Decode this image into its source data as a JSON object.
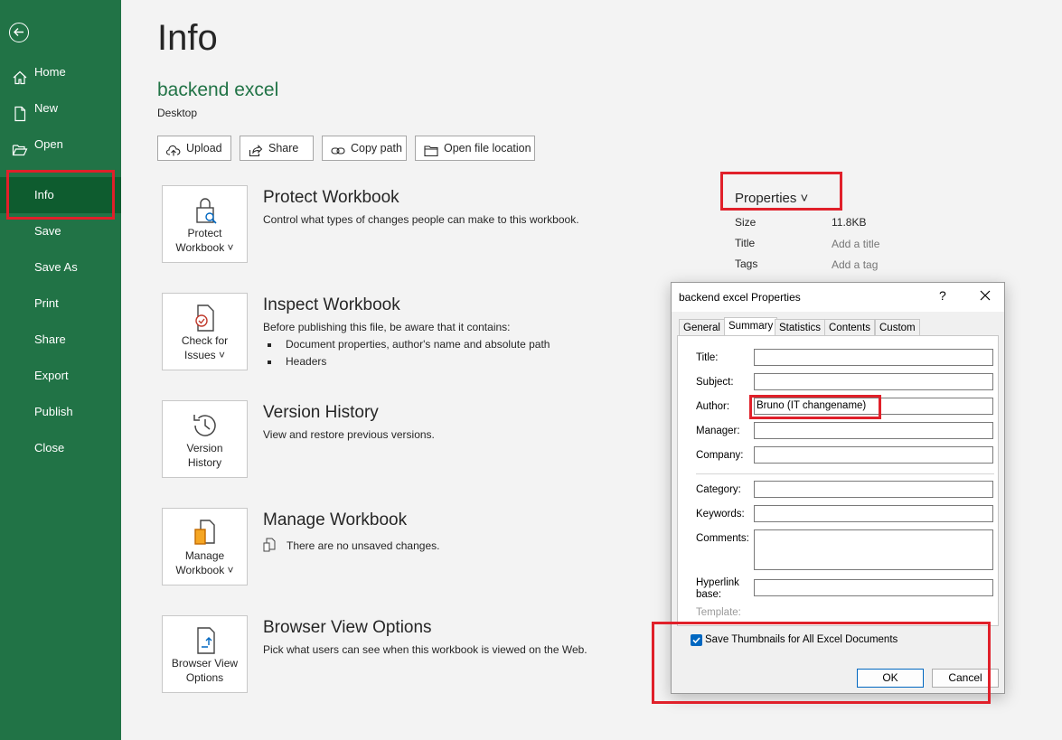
{
  "sidebar": {
    "items": [
      {
        "label": "Home"
      },
      {
        "label": "New"
      },
      {
        "label": "Open"
      },
      {
        "label": "Info"
      },
      {
        "label": "Save"
      },
      {
        "label": "Save As"
      },
      {
        "label": "Print"
      },
      {
        "label": "Share"
      },
      {
        "label": "Export"
      },
      {
        "label": "Publish"
      },
      {
        "label": "Close"
      }
    ]
  },
  "main": {
    "title": "Info",
    "file_name": "backend excel",
    "file_location": "Desktop",
    "actions": [
      {
        "label": "Upload"
      },
      {
        "label": "Share"
      },
      {
        "label": "Copy path"
      },
      {
        "label": "Open file location"
      }
    ],
    "sections": {
      "protect": {
        "tile_label": "Protect\nWorkbook ˅",
        "title": "Protect Workbook",
        "description": "Control what types of changes people can make to this workbook."
      },
      "inspect": {
        "tile_label": "Check for\nIssues ˅",
        "title": "Inspect Workbook",
        "description": "Before publishing this file, be aware that it contains:",
        "bullets": [
          "Document properties, author's name and absolute path",
          "Headers"
        ]
      },
      "version": {
        "tile_label": "Version\nHistory",
        "title": "Version History",
        "description": "View and restore previous versions."
      },
      "manage": {
        "tile_label": "Manage\nWorkbook ˅",
        "title": "Manage Workbook",
        "description": "There are no unsaved changes."
      },
      "browser": {
        "tile_label": "Browser View\nOptions",
        "title": "Browser View Options",
        "description": "Pick what users can see when this workbook is viewed on the Web."
      }
    }
  },
  "properties": {
    "header": "Properties ˅",
    "rows": [
      {
        "label": "Size",
        "value": "11.8KB"
      },
      {
        "label": "Title",
        "value": "Add a title"
      },
      {
        "label": "Tags",
        "value": "Add a tag"
      }
    ]
  },
  "dialog": {
    "title": "backend excel Properties",
    "help": "?",
    "tabs": [
      "General",
      "Summary",
      "Statistics",
      "Contents",
      "Custom"
    ],
    "active_tab": "Summary",
    "fields": [
      {
        "label": "Title:",
        "value": ""
      },
      {
        "label": "Subject:",
        "value": ""
      },
      {
        "label": "Author:",
        "value": "Bruno (IT changename)"
      },
      {
        "label": "Manager:",
        "value": ""
      },
      {
        "label": "Company:",
        "value": ""
      },
      {
        "label": "Category:",
        "value": ""
      },
      {
        "label": "Keywords:",
        "value": ""
      },
      {
        "label": "Comments:",
        "value": ""
      },
      {
        "label": "Hyperlink base:",
        "value": ""
      }
    ],
    "template_label": "Template:",
    "checkbox_label": "Save Thumbnails for All Excel Documents",
    "checkbox_checked": true,
    "ok_label": "OK",
    "cancel_label": "Cancel"
  },
  "colors": {
    "sidebar": "#217346",
    "sidebar_active": "#0e5c2f",
    "accent_blue": "#0067c0",
    "annotation_red": "#e0202a"
  }
}
